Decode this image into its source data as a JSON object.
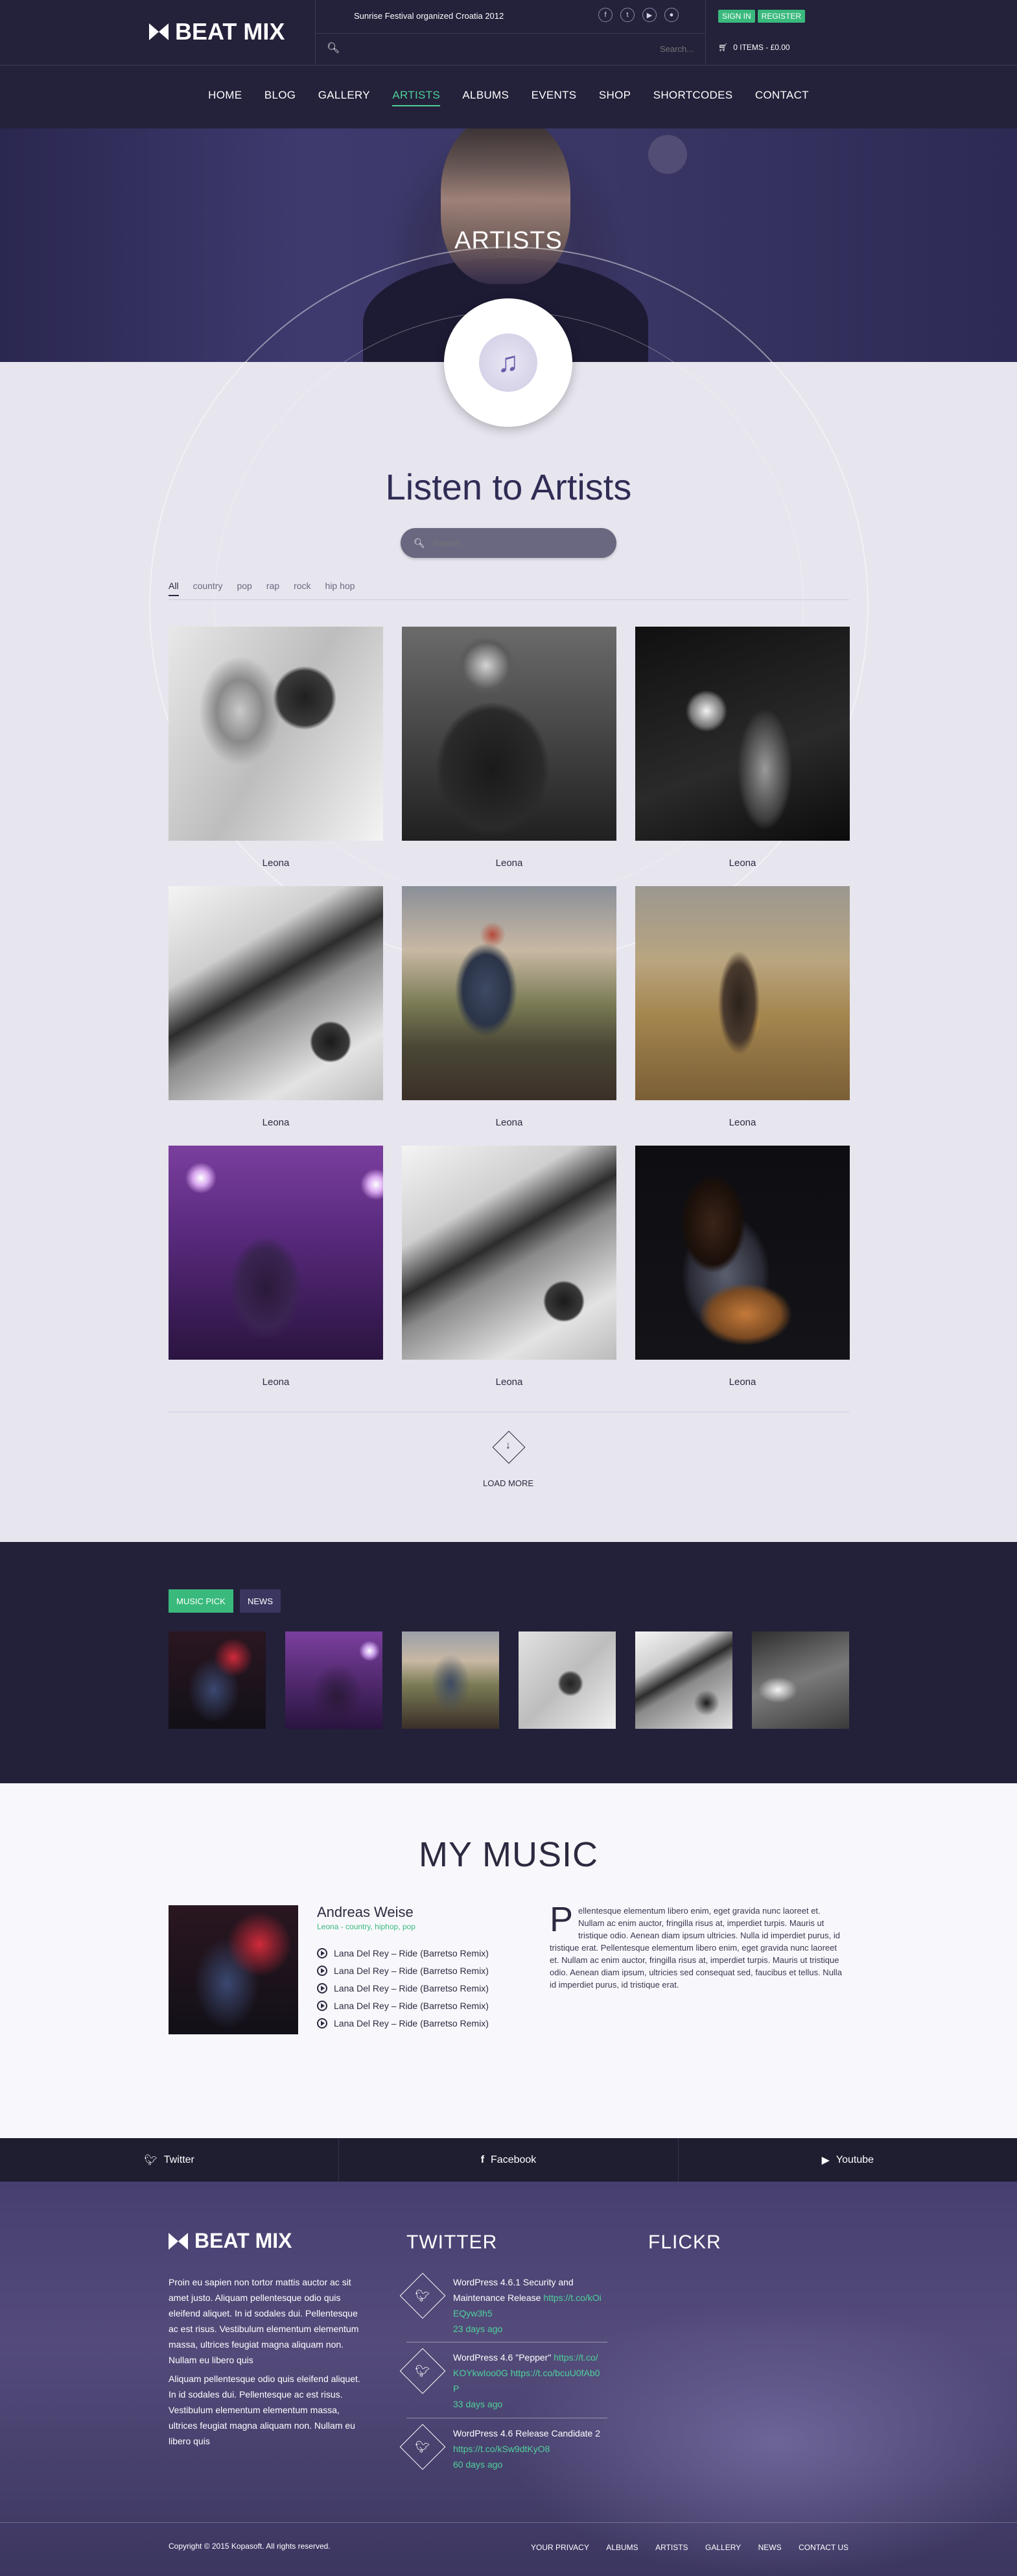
{
  "header": {
    "logo": "BEAT MIX",
    "announcement": "Sunrise Festival organized Croatia 2012",
    "social_icons": [
      "facebook-icon",
      "twitter-icon",
      "youtube-icon",
      "apple-icon"
    ],
    "sign_in": "SIGN IN",
    "register": "REGISTER",
    "search_placeholder": "Search...",
    "cart": "0 ITEMS - £0.00"
  },
  "nav": [
    "HOME",
    "BLOG",
    "GALLERY",
    "ARTISTS",
    "ALBUMS",
    "EVENTS",
    "SHOP",
    "SHORTCODES",
    "CONTACT"
  ],
  "hero": {
    "title": "ARTISTS"
  },
  "artists_section": {
    "title": "Listen to Artists",
    "search_placeholder": "Search...",
    "filters": [
      "All",
      "country",
      "pop",
      "rap",
      "rock",
      "hip hop"
    ],
    "grid": [
      {
        "name": "Leona"
      },
      {
        "name": "Leona"
      },
      {
        "name": "Leona"
      },
      {
        "name": "Leona"
      },
      {
        "name": "Leona"
      },
      {
        "name": "Leona"
      },
      {
        "name": "Leona"
      },
      {
        "name": "Leona"
      },
      {
        "name": "Leona"
      }
    ],
    "load_more": "LOAD MORE"
  },
  "picks": {
    "tabs": [
      "MUSIC PICK",
      "NEWS"
    ]
  },
  "my_music": {
    "title": "MY MUSIC",
    "artist": "Andreas Weise",
    "genres": "Leona - country, hiphop, pop",
    "tracks": [
      "Lana Del Rey – Ride (Barretso Remix)",
      "Lana Del Rey – Ride (Barretso Remix)",
      "Lana Del Rey – Ride (Barretso Remix)",
      "Lana Del Rey – Ride (Barretso Remix)",
      "Lana Del Rey – Ride (Barretso Remix)"
    ],
    "dropcap": "P",
    "text": "ellentesque elementum libero enim, eget gravida nunc laoreet et. Nullam ac enim auctor, fringilla risus at, imperdiet turpis. Mauris ut tristique odio. Aenean diam ipsum ultricies. Nulla id imperdiet purus, id tristique erat. Pellentesque elementum libero enim, eget gravida nunc laoreet et. Nullam ac enim auctor, fringilla risus at, imperdiet turpis. Mauris ut tristique odio. Aenean diam ipsum, ultricies sed consequat sed, faucibus et tellus. Nulla id imperdiet purus, id tristique erat."
  },
  "social_bar": [
    {
      "icon": "twitter-icon",
      "label": "Twitter"
    },
    {
      "icon": "facebook-icon",
      "label": "Facebook"
    },
    {
      "icon": "youtube-icon",
      "label": "Youtube"
    }
  ],
  "footer": {
    "logo": "BEAT MIX",
    "about_1": "Proin eu sapien non tortor mattis auctor ac sit amet justo. Aliquam pellentesque odio quis eleifend aliquet. In id sodales dui. Pellentesque ac est risus. Vestibulum elementum elementum massa, ultrices feugiat magna aliquam non. Nullam eu libero quis",
    "about_2": "Aliquam pellentesque odio quis eleifend aliquet. In id sodales dui. Pellentesque ac est risus. Vestibulum elementum elementum massa, ultrices feugiat magna aliquam non. Nullam eu libero quis",
    "twitter_title": "TWITTER",
    "tweets": [
      {
        "text": "WordPress 4.6.1 Security and Maintenance Release ",
        "link": "https://t.co/kOiEQyw3h5",
        "time": "23 days ago"
      },
      {
        "text": "WordPress 4.6 \"Pepper\" ",
        "link": "https://t.co/KOYkwIoo0G https://t.co/bcuU0fAb0P",
        "time": "33 days ago"
      },
      {
        "text": "WordPress 4.6 Release Candidate 2 ",
        "link": "https://t.co/kSw9dtKyO8",
        "time": "60 days ago"
      }
    ],
    "flickr_title": "FLICKR",
    "copyright": "Copyright © 2015 Kopasoft. All rights reserved.",
    "links": [
      "YOUR PRIVACY",
      "ALBUMS",
      "ARTISTS",
      "GALLERY",
      "NEWS",
      "CONTACT US"
    ]
  },
  "colors": {
    "accent": "#39b97c",
    "dark": "#23203a",
    "link": "#4fd19a"
  }
}
